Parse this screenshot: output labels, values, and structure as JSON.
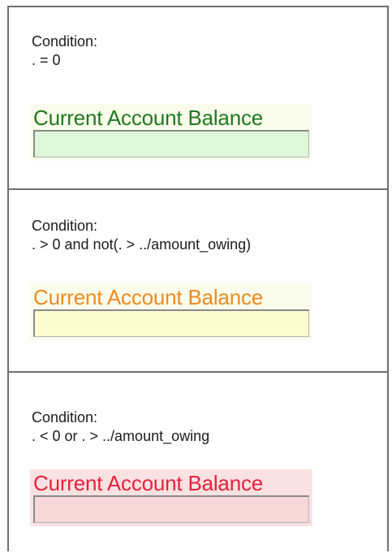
{
  "sections": [
    {
      "condition_label": "Condition:",
      "condition_expr": ". = 0",
      "field_label": "Current Account Balance",
      "field_value": "",
      "label_color": "#1e7a1e",
      "input_bg": "#dcf8d8",
      "box_bg": "#fbfdec"
    },
    {
      "condition_label": "Condition:",
      "condition_expr": ". > 0 and not(. > ../amount_owing)",
      "field_label": "Current Account Balance",
      "field_value": "",
      "label_color": "#f08a1c",
      "input_bg": "#fdfbd2",
      "box_bg": "#fbfdec"
    },
    {
      "condition_label": "Condition:",
      "condition_expr": ". < 0 or . > ../amount_owing",
      "field_label": "Current Account Balance",
      "field_value": "",
      "label_color": "#ee1f3a",
      "input_bg": "#f7d7d7",
      "box_bg": "#fbe2e2"
    }
  ]
}
